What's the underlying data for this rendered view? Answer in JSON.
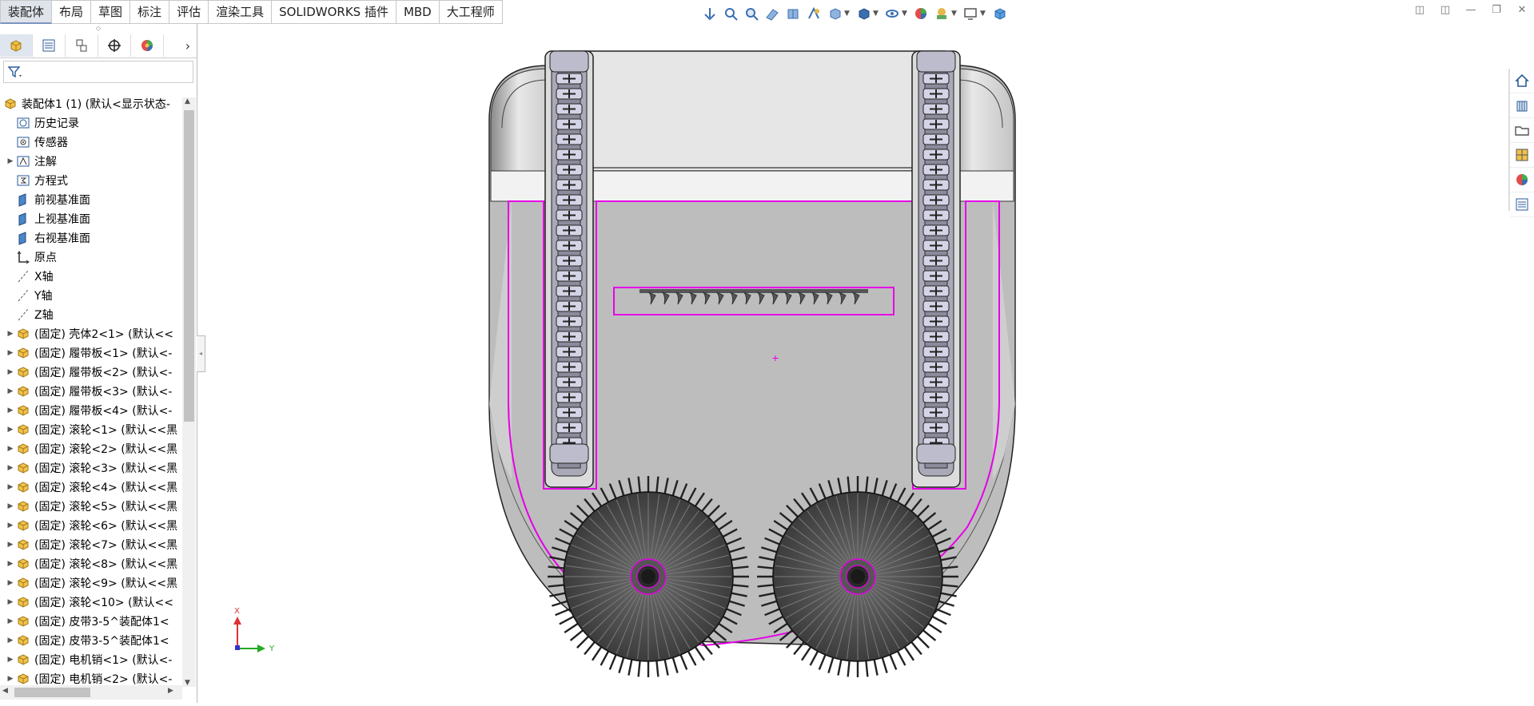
{
  "tabs": [
    "装配体",
    "布局",
    "草图",
    "标注",
    "评估",
    "渲染工具",
    "SOLIDWORKS 插件",
    "MBD",
    "大工程师"
  ],
  "active_tab": "装配体",
  "hud_icons": [
    "view-orientation-icon",
    "zoom-to-fit-icon",
    "zoom-to-area-icon",
    "previous-view-icon",
    "section-view-icon",
    "dynamic-annotation-icon",
    "view-orientation-cube-icon",
    "display-style-icon",
    "hide-show-items-icon",
    "edit-appearance-icon",
    "apply-scene-icon",
    "view-settings-icon",
    "3d-view-icon"
  ],
  "feature_tree": {
    "root": "装配体1 (1)  (默认<显示状态-",
    "items": [
      {
        "label": "历史记录",
        "icon": "history-icon",
        "expandable": false
      },
      {
        "label": "传感器",
        "icon": "sensor-icon",
        "expandable": false
      },
      {
        "label": "注解",
        "icon": "annotation-icon",
        "expandable": true
      },
      {
        "label": "方程式",
        "icon": "equation-icon",
        "expandable": false
      },
      {
        "label": "前视基准面",
        "icon": "plane-icon",
        "expandable": false
      },
      {
        "label": "上视基准面",
        "icon": "plane-icon",
        "expandable": false
      },
      {
        "label": "右视基准面",
        "icon": "plane-icon",
        "expandable": false
      },
      {
        "label": "原点",
        "icon": "origin-icon",
        "expandable": false
      },
      {
        "label": "X轴",
        "icon": "axis-icon",
        "expandable": false
      },
      {
        "label": "Y轴",
        "icon": "axis-icon",
        "expandable": false
      },
      {
        "label": "Z轴",
        "icon": "axis-icon",
        "expandable": false
      },
      {
        "label": "(固定) 壳体2<1> (默认<<",
        "icon": "part-icon",
        "expandable": true
      },
      {
        "label": "(固定) 履带板<1> (默认<-",
        "icon": "part-icon",
        "expandable": true
      },
      {
        "label": "(固定) 履带板<2> (默认<-",
        "icon": "part-icon",
        "expandable": true
      },
      {
        "label": "(固定) 履带板<3> (默认<-",
        "icon": "part-icon",
        "expandable": true
      },
      {
        "label": "(固定) 履带板<4> (默认<-",
        "icon": "part-icon",
        "expandable": true
      },
      {
        "label": "(固定) 滚轮<1> (默认<<黑",
        "icon": "part-icon",
        "expandable": true
      },
      {
        "label": "(固定) 滚轮<2> (默认<<黑",
        "icon": "part-icon",
        "expandable": true
      },
      {
        "label": "(固定) 滚轮<3> (默认<<黑",
        "icon": "part-icon",
        "expandable": true
      },
      {
        "label": "(固定) 滚轮<4> (默认<<黑",
        "icon": "part-icon",
        "expandable": true
      },
      {
        "label": "(固定) 滚轮<5> (默认<<黑",
        "icon": "part-icon",
        "expandable": true
      },
      {
        "label": "(固定) 滚轮<6> (默认<<黑",
        "icon": "part-icon",
        "expandable": true
      },
      {
        "label": "(固定) 滚轮<7> (默认<<黑",
        "icon": "part-icon",
        "expandable": true
      },
      {
        "label": "(固定) 滚轮<8> (默认<<黑",
        "icon": "part-icon",
        "expandable": true
      },
      {
        "label": "(固定) 滚轮<9> (默认<<黑",
        "icon": "part-icon",
        "expandable": true
      },
      {
        "label": "(固定) 滚轮<10> (默认<<",
        "icon": "part-icon",
        "expandable": true
      },
      {
        "label": "(固定) 皮带3-5^装配体1<",
        "icon": "part-icon",
        "expandable": true
      },
      {
        "label": "(固定) 皮带3-5^装配体1<",
        "icon": "part-icon",
        "expandable": true
      },
      {
        "label": "(固定) 电机销<1> (默认<-",
        "icon": "part-icon",
        "expandable": true
      },
      {
        "label": "(固定) 电机销<2> (默认<-",
        "icon": "part-icon",
        "expandable": true
      }
    ]
  },
  "triad": {
    "x_label": "X",
    "y_label": "Y"
  },
  "task_pane_icons": [
    "solidworks-resources-icon",
    "design-library-icon",
    "file-explorer-icon",
    "view-palette-icon",
    "appearances-icon",
    "custom-properties-icon"
  ],
  "colors": {
    "sketch": "#e600e6",
    "tab_active": "#dfe3ea",
    "body": "#c0c0c0"
  }
}
